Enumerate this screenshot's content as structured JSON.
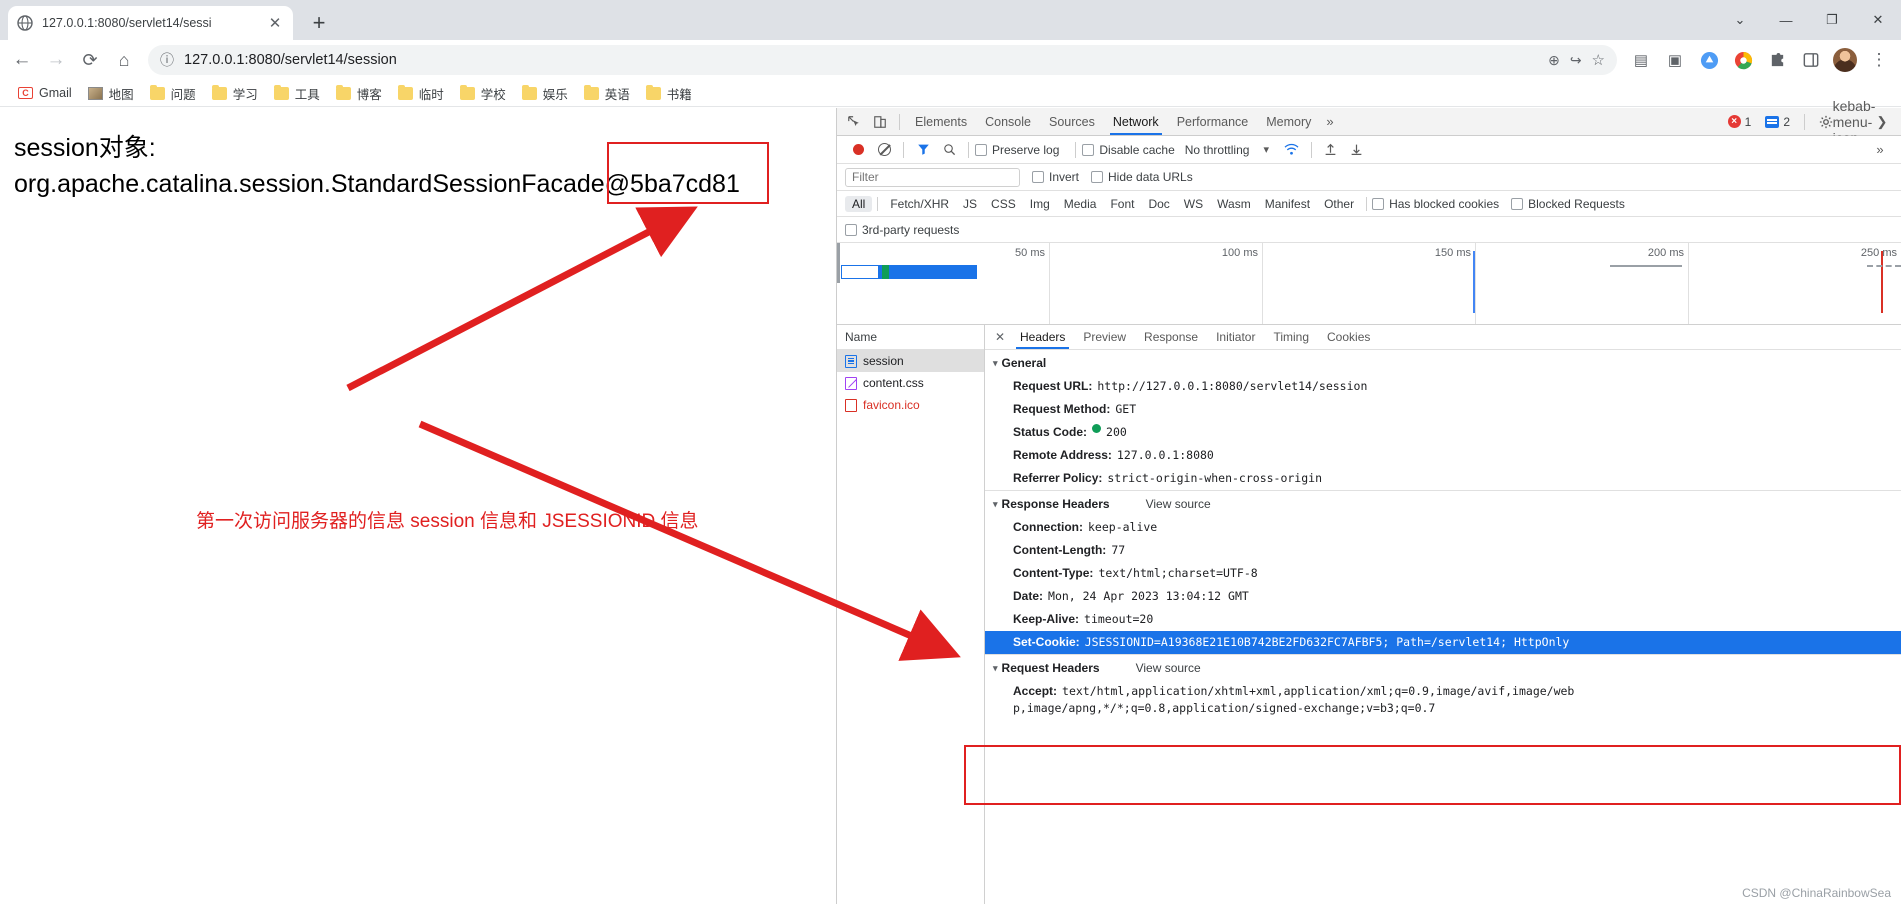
{
  "window": {
    "minimize_label": "—",
    "maximize_label": "❐",
    "close_label": "✕",
    "menu_caret_label": "⌄"
  },
  "tab": {
    "title": "127.0.0.1:8080/servlet14/sessi",
    "favicon_name": "globe-icon",
    "close_label": "✕",
    "newtab_label": "+"
  },
  "toolbar": {
    "back_label": "←",
    "forward_label": "→",
    "reload_label": "⟳",
    "home_label": "⌂",
    "info_label": "ⓘ",
    "url": "127.0.0.1:8080/servlet14/session",
    "zoom_label": "⊕",
    "share_label": "↪",
    "bookmark_star_label": "☆",
    "reading_list_label": "▤",
    "split_label": "▣",
    "menu_label": "⋮"
  },
  "bookmarks": [
    {
      "label": "Gmail",
      "icon": "gmail-icon"
    },
    {
      "label": "地图",
      "icon": "map-icon"
    },
    {
      "label": "问题",
      "icon": "folder-icon"
    },
    {
      "label": "学习",
      "icon": "folder-icon"
    },
    {
      "label": "工具",
      "icon": "folder-icon"
    },
    {
      "label": "博客",
      "icon": "folder-icon"
    },
    {
      "label": "临时",
      "icon": "folder-icon"
    },
    {
      "label": "学校",
      "icon": "folder-icon"
    },
    {
      "label": "娱乐",
      "icon": "folder-icon"
    },
    {
      "label": "英语",
      "icon": "folder-icon"
    },
    {
      "label": "书籍",
      "icon": "folder-icon"
    }
  ],
  "page": {
    "body_line1": "session对象:",
    "body_line2": "org.apache.catalina.session.StandardSessionFacade@5ba7cd81",
    "annotation_text": "第一次访问服务器的信息 session 信息和 JSESSIONID 信息",
    "annotation_color": "#e02020"
  },
  "devtools": {
    "inspect_icon": "inspect-element-icon",
    "device_icon": "device-toolbar-icon",
    "panels": [
      {
        "label": "Elements",
        "active": false
      },
      {
        "label": "Console",
        "active": false
      },
      {
        "label": "Sources",
        "active": false
      },
      {
        "label": "Network",
        "active": true
      },
      {
        "label": "Performance",
        "active": false
      },
      {
        "label": "Memory",
        "active": false
      }
    ],
    "more_panels_label": "»",
    "error_count": "1",
    "message_count": "2",
    "settings_icon": "gear-icon",
    "kebab_icon": "kebab-menu-icon",
    "dock_close_icon": "close-devtools-icon",
    "network_toolbar": {
      "record_icon": "record-button-icon",
      "clear_icon": "clear-network-log-icon",
      "filter_icon": "filter-funnel-icon",
      "search_icon": "search-icon",
      "preserve_log": "Preserve log",
      "disable_cache": "Disable cache",
      "throttling": "No throttling",
      "throttling_caret": "▾",
      "wifi_icon": "network-conditions-icon",
      "import_icon": "import-har-icon",
      "export_icon": "export-har-icon",
      "overflow_caret": "»"
    },
    "filter_bar": {
      "placeholder": "Filter",
      "value": "",
      "invert": "Invert",
      "hide_data_urls": "Hide data URLs"
    },
    "type_filters": [
      {
        "label": "All",
        "active": true
      },
      {
        "label": "Fetch/XHR",
        "active": false
      },
      {
        "label": "JS",
        "active": false
      },
      {
        "label": "CSS",
        "active": false
      },
      {
        "label": "Img",
        "active": false
      },
      {
        "label": "Media",
        "active": false
      },
      {
        "label": "Font",
        "active": false
      },
      {
        "label": "Doc",
        "active": false
      },
      {
        "label": "WS",
        "active": false
      },
      {
        "label": "Wasm",
        "active": false
      },
      {
        "label": "Manifest",
        "active": false
      },
      {
        "label": "Other",
        "active": false
      }
    ],
    "extra_filters": [
      {
        "label": "Has blocked cookies"
      },
      {
        "label": "Blocked Requests"
      }
    ],
    "third_party": "3rd-party requests",
    "timeline_ticks": [
      "50 ms",
      "100 ms",
      "150 ms",
      "200 ms",
      "250 ms"
    ],
    "requests_header": "Name",
    "requests": [
      {
        "name": "session",
        "icon": "document-icon",
        "state": "selected"
      },
      {
        "name": "content.css",
        "icon": "stylesheet-icon",
        "state": "normal"
      },
      {
        "name": "favicon.ico",
        "icon": "failed-request-icon",
        "state": "error"
      }
    ],
    "detail_tabs": [
      {
        "label": "Headers",
        "active": true
      },
      {
        "label": "Preview",
        "active": false
      },
      {
        "label": "Response",
        "active": false
      },
      {
        "label": "Initiator",
        "active": false
      },
      {
        "label": "Timing",
        "active": false
      },
      {
        "label": "Cookies",
        "active": false
      }
    ],
    "detail_close_label": "✕",
    "general": {
      "title": "General",
      "rows": [
        {
          "key": "Request URL:",
          "value": "http://127.0.0.1:8080/servlet14/session"
        },
        {
          "key": "Request Method:",
          "value": "GET"
        },
        {
          "key": "Status Code:",
          "value": "200",
          "has_status_dot": true
        },
        {
          "key": "Remote Address:",
          "value": "127.0.0.1:8080"
        },
        {
          "key": "Referrer Policy:",
          "value": "strict-origin-when-cross-origin"
        }
      ]
    },
    "response_headers": {
      "title": "Response Headers",
      "view_source": "View source",
      "rows": [
        {
          "key": "Connection:",
          "value": "keep-alive"
        },
        {
          "key": "Content-Length:",
          "value": "77"
        },
        {
          "key": "Content-Type:",
          "value": "text/html;charset=UTF-8"
        },
        {
          "key": "Date:",
          "value": "Mon, 24 Apr 2023 13:04:12 GMT"
        },
        {
          "key": "Keep-Alive:",
          "value": "timeout=20"
        },
        {
          "key": "Set-Cookie:",
          "value": "JSESSIONID=A19368E21E10B742BE2FD632FC7AFBF5; Path=/servlet14; HttpOnly",
          "highlighted": true
        }
      ]
    },
    "request_headers": {
      "title": "Request Headers",
      "view_source": "View source",
      "rows": [
        {
          "key": "Accept:",
          "value": "text/html,application/xhtml+xml,application/xml;q=0.9,image/avif,image/web"
        },
        {
          "key": "",
          "value": "p,image/apng,*/*;q=0.8,application/signed-exchange;v=b3;q=0.7"
        }
      ]
    }
  },
  "watermark": "CSDN @ChinaRainbowSea"
}
